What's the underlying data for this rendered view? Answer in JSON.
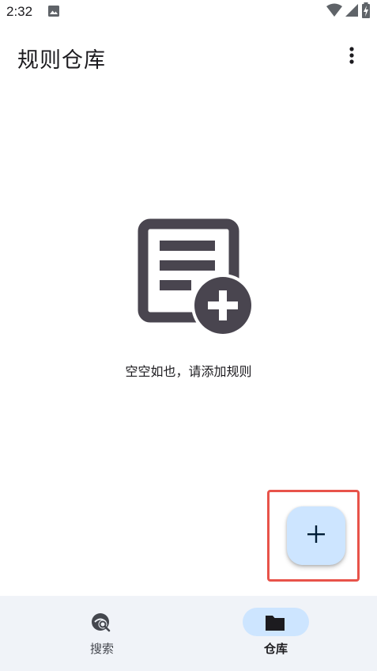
{
  "status_bar": {
    "time": "2:32",
    "icons": [
      "image-icon",
      "wifi-icon",
      "signal-icon",
      "battery-charging-icon"
    ]
  },
  "app_bar": {
    "title": "规则仓库",
    "menu_icon": "more-vert-icon"
  },
  "empty_state": {
    "icon": "note-add-icon",
    "message": "空空如也，请添加规则"
  },
  "fab": {
    "icon": "add-icon"
  },
  "bottom_nav": {
    "items": [
      {
        "label": "搜索",
        "icon": "search-rules-icon",
        "selected": false
      },
      {
        "label": "仓库",
        "icon": "folder-icon",
        "selected": true
      }
    ]
  },
  "colors": {
    "accent_container": "#cde5ff",
    "nav_background": "#f0f3f8",
    "icon_dark": "#49454f",
    "highlight_border": "#e8534a",
    "fab_icon": "#001d36"
  }
}
